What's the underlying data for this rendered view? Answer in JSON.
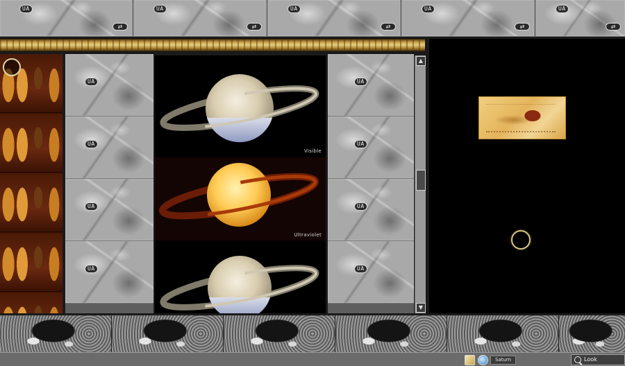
{
  "top_strip": {
    "tiles": [
      {
        "label": "UA",
        "button": "⇄"
      },
      {
        "label": "UA",
        "button": "⇄"
      },
      {
        "label": "UA",
        "button": "⇄"
      },
      {
        "label": "UA",
        "button": "⇄"
      },
      {
        "label": "UA",
        "button": "⇄"
      }
    ]
  },
  "left_panel": {
    "tile_label": "UA",
    "tile_count": 4
  },
  "right_panel": {
    "tile_label": "UA",
    "tile_count": 4
  },
  "planet_panel": {
    "frames": [
      {
        "caption": "Visible",
        "style": "visible"
      },
      {
        "caption": "Ultraviolet",
        "style": "ultraviolet"
      },
      {
        "caption": "",
        "style": "visible"
      }
    ]
  },
  "scrollbar": {
    "up_arrow": "▲",
    "down_arrow": "▼"
  },
  "taskbar": {
    "app_label": "Saturn",
    "tray_text": "Look",
    "tray_icon": "search-icon"
  },
  "colors": {
    "gold": "#c9a44c",
    "planet_cream": "#e8dcc0",
    "ultraviolet_core": "#ffcc55",
    "ultraviolet_ring": "#a83a0a",
    "parchment": "#e4b45c"
  }
}
